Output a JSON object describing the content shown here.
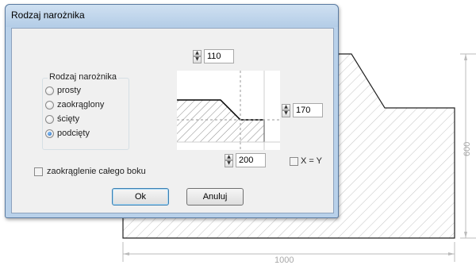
{
  "window": {
    "title": "Rodzaj narożnika"
  },
  "corner_group": {
    "title": "Rodzaj narożnika",
    "options": [
      {
        "label": "prosty",
        "checked": false
      },
      {
        "label": "zaokrąglony",
        "checked": false
      },
      {
        "label": "ścięty",
        "checked": false
      },
      {
        "label": "podcięty",
        "checked": true
      }
    ]
  },
  "round_whole_side": {
    "label": "zaokrąglenie całego boku",
    "checked": false
  },
  "inputs": {
    "top_value": "110",
    "right_value": "170",
    "bottom_value": "200"
  },
  "x_equals_y": {
    "label": "X = Y",
    "checked": false
  },
  "buttons": {
    "ok": "Ok",
    "cancel": "Anuluj"
  },
  "background_dimensions": {
    "height": "600",
    "width": "1000"
  }
}
